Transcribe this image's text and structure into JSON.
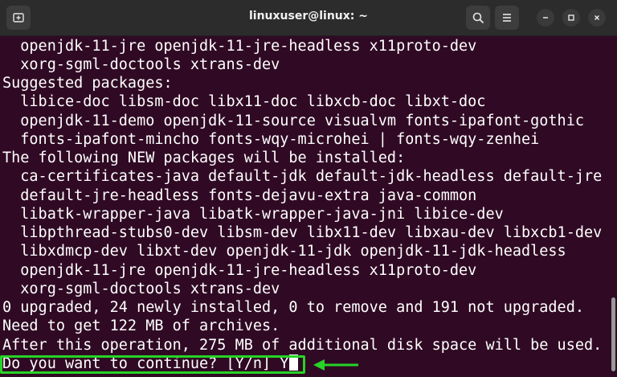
{
  "window": {
    "title": "linuxuser@linux: ~",
    "icons": [
      "new-tab-icon",
      "search-icon",
      "hamburger-menu-icon",
      "minimize-icon",
      "maximize-icon",
      "close-icon"
    ]
  },
  "terminal": {
    "lines": [
      "  openjdk-11-jre openjdk-11-jre-headless x11proto-dev",
      "  xorg-sgml-doctools xtrans-dev",
      "Suggested packages:",
      "  libice-doc libsm-doc libx11-doc libxcb-doc libxt-doc",
      "  openjdk-11-demo openjdk-11-source visualvm fonts-ipafont-gothic",
      "  fonts-ipafont-mincho fonts-wqy-microhei | fonts-wqy-zenhei",
      "The following NEW packages will be installed:",
      "  ca-certificates-java default-jdk default-jdk-headless default-jre",
      "  default-jre-headless fonts-dejavu-extra java-common",
      "  libatk-wrapper-java libatk-wrapper-java-jni libice-dev",
      "  libpthread-stubs0-dev libsm-dev libx11-dev libxau-dev libxcb1-dev",
      "  libxdmcp-dev libxt-dev openjdk-11-jdk openjdk-11-jdk-headless",
      "  openjdk-11-jre openjdk-11-jre-headless x11proto-dev",
      "  xorg-sgml-doctools xtrans-dev",
      "0 upgraded, 24 newly installed, 0 to remove and 191 not upgraded.",
      "Need to get 122 MB of archives.",
      "After this operation, 275 MB of additional disk space will be used."
    ],
    "prompt": "Do you want to continue? [Y/n] Y"
  },
  "colors": {
    "terminal_bg": "#300a24",
    "titlebar_bg": "#2c2c2c",
    "text": "#ffffff",
    "highlight": "#27d327"
  }
}
